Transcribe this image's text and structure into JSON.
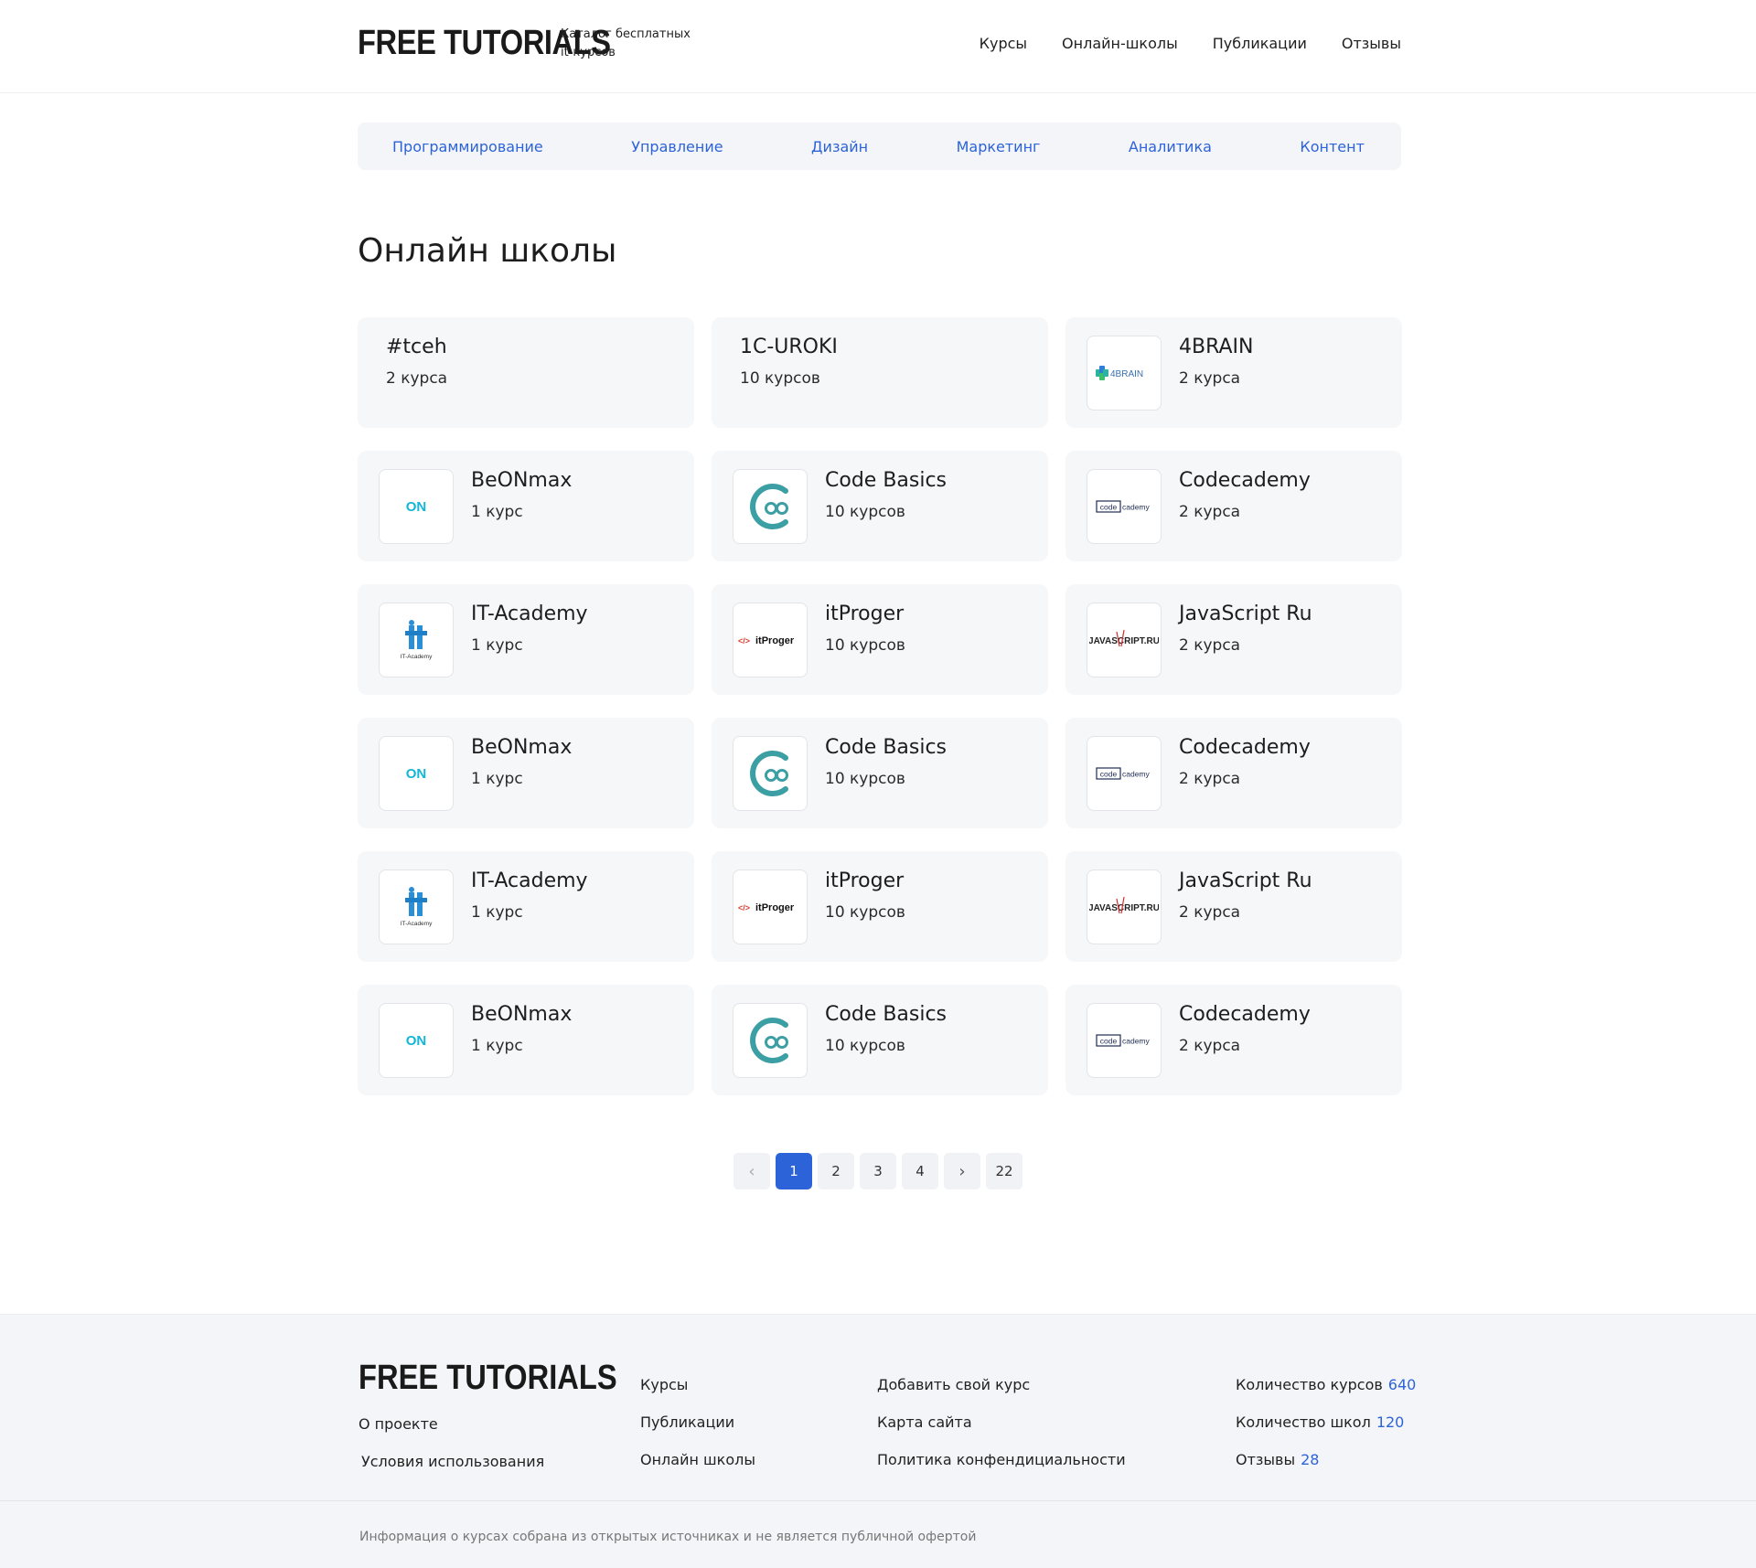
{
  "header": {
    "logo": "FREE TUTORIALS",
    "tagline": "Каталог бесплатных it-курсов",
    "nav": [
      "Курсы",
      "Онлайн-школы",
      "Публикации",
      "Отзывы"
    ]
  },
  "categories": [
    "Программирование",
    "Управление",
    "Дизайн",
    "Маркетинг",
    "Аналитика",
    "Контент"
  ],
  "page_title": "Онлайн школы",
  "schools": [
    {
      "name": "#tceh",
      "count": "2 курса",
      "logo": ""
    },
    {
      "name": "1C-UROKI",
      "count": "10 курсов",
      "logo": ""
    },
    {
      "name": "4BRAIN",
      "count": "2 курса",
      "logo": "4brain"
    },
    {
      "name": "BeONmax",
      "count": "1 курс",
      "logo": "beonmax"
    },
    {
      "name": "Code Basics",
      "count": "10 курсов",
      "logo": "codebasics"
    },
    {
      "name": "Codecademy",
      "count": "2 курса",
      "logo": "codecademy"
    },
    {
      "name": "IT-Academy",
      "count": "1 курс",
      "logo": "itacademy"
    },
    {
      "name": "itProger",
      "count": "10 курсов",
      "logo": "itproger"
    },
    {
      "name": "JavaScript Ru",
      "count": "2 курса",
      "logo": "javascriptru"
    },
    {
      "name": "BeONmax",
      "count": "1 курс",
      "logo": "beonmax"
    },
    {
      "name": "Code Basics",
      "count": "10 курсов",
      "logo": "codebasics"
    },
    {
      "name": "Codecademy",
      "count": "2 курса",
      "logo": "codecademy"
    },
    {
      "name": "IT-Academy",
      "count": "1 курс",
      "logo": "itacademy"
    },
    {
      "name": "itProger",
      "count": "10 курсов",
      "logo": "itproger"
    },
    {
      "name": "JavaScript Ru",
      "count": "2 курса",
      "logo": "javascriptru"
    },
    {
      "name": "BeONmax",
      "count": "1 курс",
      "logo": "beonmax"
    },
    {
      "name": "Code Basics",
      "count": "10 курсов",
      "logo": "codebasics"
    },
    {
      "name": "Codecademy",
      "count": "2 курса",
      "logo": "codecademy"
    }
  ],
  "logo_text": {
    "4brain": "4BRAIN",
    "beonmax": "ON",
    "codecademy_a": "code",
    "codecademy_b": "cademy",
    "itacademy": "IT-Academy",
    "itproger_tag": "</>",
    "itproger": "itProger",
    "javascriptru": "JAVASCRIPT.RU"
  },
  "pagination": {
    "prev": "‹",
    "pages": [
      "1",
      "2",
      "3",
      "4"
    ],
    "next": "›",
    "last": "22",
    "current": "1"
  },
  "footer": {
    "logo": "FREE TUTORIALS",
    "col1": [
      "О проекте",
      "Условия использования"
    ],
    "col2": [
      "Курсы",
      "Публикации",
      "Онлайн школы"
    ],
    "col3": [
      "Добавить свой курс",
      "Карта сайта",
      "Политика конфендициальности"
    ],
    "stats": [
      {
        "label": "Количество курсов",
        "value": "640"
      },
      {
        "label": "Количество школ",
        "value": "120"
      },
      {
        "label": "Отзывы",
        "value": "28"
      }
    ],
    "disclaimer": "Информация о курсах собрана из открытых источниках и не является публичной офертой"
  },
  "colors": {
    "accent": "#2d63d8",
    "card_bg": "#f6f7f9",
    "footer_bg": "#f4f5f9"
  }
}
